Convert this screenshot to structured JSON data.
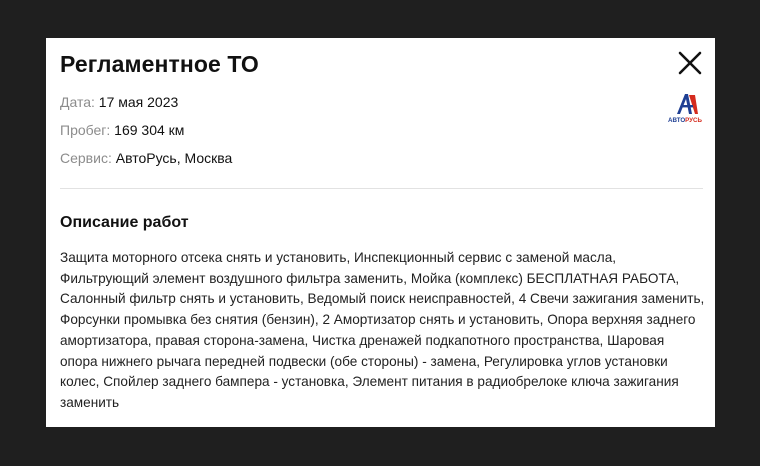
{
  "modal": {
    "title": "Регламентное ТО",
    "close_label": "Закрыть"
  },
  "details": {
    "date_label": "Дата:",
    "date_value": "17 мая 2023",
    "mileage_label": "Пробег:",
    "mileage_value": "169 304 км",
    "service_label": "Сервис:",
    "service_value": "АвтоРусь, Москва"
  },
  "logo": {
    "text_part1": "АВТО",
    "text_part2": "РУСЬ",
    "primary_color": "#1f3f93",
    "accent_color": "#d52b1e"
  },
  "works": {
    "section_title": "Описание работ",
    "description": "Защита моторного отсека снять и установить, Инспекционный сервис с заменой масла, Фильтрующий элемент воздушного фильтра заменить, Мойка (комплекс) БЕСПЛАТНАЯ РАБОТА, Салонный фильтр снять и установить, Ведомый поиск неисправностей, 4 Свечи зажигания заменить, Форсунки промывка без снятия (бензин), 2 Амортизатор снять и установить, Опора верхняя заднего амортизатора, правая сторона-замена, Чистка дренажей подкапотного пространства, Шаровая опора нижнего рычага передней подвески (обе стороны) - замена, Регулировка углов установки колес, Спойлер заднего бампера - установка, Элемент питания в радиобрелоке ключа зажигания заменить"
  }
}
